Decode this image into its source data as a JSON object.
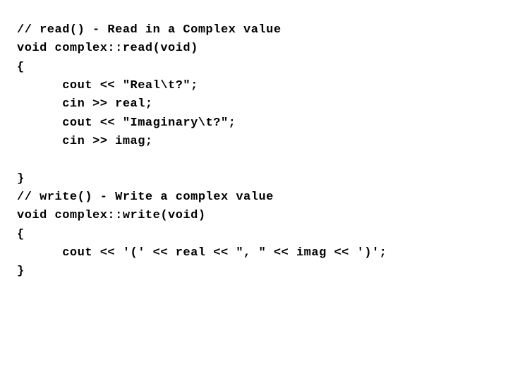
{
  "code": {
    "lines": [
      "// read() - Read in a Complex value",
      "void complex::read(void)",
      "{",
      "      cout << \"Real\\t?\";",
      "      cin >> real;",
      "      cout << \"Imaginary\\t?\";",
      "      cin >> imag;",
      "",
      "}",
      "// write() - Write a complex value",
      "void complex::write(void)",
      "{",
      "      cout << '(' << real << \", \" << imag << ')';",
      "}"
    ]
  }
}
